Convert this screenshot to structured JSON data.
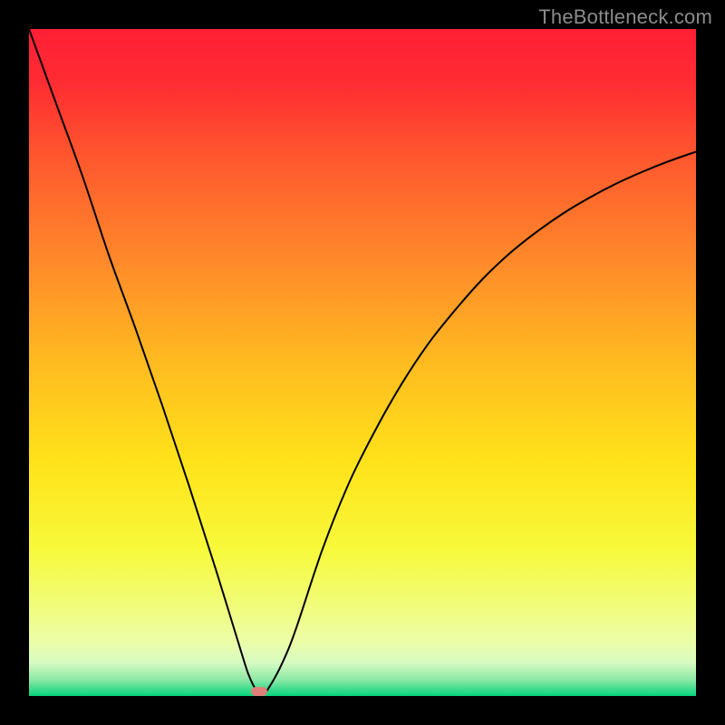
{
  "watermark": "TheBottleneck.com",
  "chart_data": {
    "type": "line",
    "title": "",
    "xlabel": "",
    "ylabel": "",
    "xlim": [
      0,
      100
    ],
    "ylim": [
      0,
      100
    ],
    "background_gradient": {
      "stops": [
        {
          "pos": 0.0,
          "color": "#ff1f35"
        },
        {
          "pos": 0.08,
          "color": "#ff2c32"
        },
        {
          "pos": 0.2,
          "color": "#ff5a2e"
        },
        {
          "pos": 0.35,
          "color": "#ff8a2a"
        },
        {
          "pos": 0.5,
          "color": "#ffbb20"
        },
        {
          "pos": 0.65,
          "color": "#ffe31a"
        },
        {
          "pos": 0.78,
          "color": "#f7f93a"
        },
        {
          "pos": 0.86,
          "color": "#f1fd77"
        },
        {
          "pos": 0.92,
          "color": "#ecfda9"
        },
        {
          "pos": 0.95,
          "color": "#d6fbc2"
        },
        {
          "pos": 0.975,
          "color": "#8fe9a6"
        },
        {
          "pos": 1.0,
          "color": "#07d47d"
        }
      ]
    },
    "series": [
      {
        "name": "curve",
        "color": "#000000",
        "x": [
          0,
          4,
          8,
          12,
          16,
          20,
          24,
          28,
          32,
          33,
          34,
          35,
          36,
          38,
          40,
          44,
          48,
          52,
          56,
          60,
          64,
          68,
          72,
          76,
          80,
          84,
          88,
          92,
          96,
          100
        ],
        "y": [
          100,
          89,
          78,
          66,
          55,
          43.5,
          31.5,
          19,
          6,
          3,
          1,
          0.3,
          1.3,
          5,
          10,
          22,
          32,
          40,
          47,
          53,
          58,
          62.5,
          66.3,
          69.5,
          72.3,
          74.7,
          76.8,
          78.6,
          80.2,
          81.6
        ]
      }
    ],
    "marker": {
      "x": 34.5,
      "y": 0.7,
      "color": "#e07f7a"
    }
  }
}
